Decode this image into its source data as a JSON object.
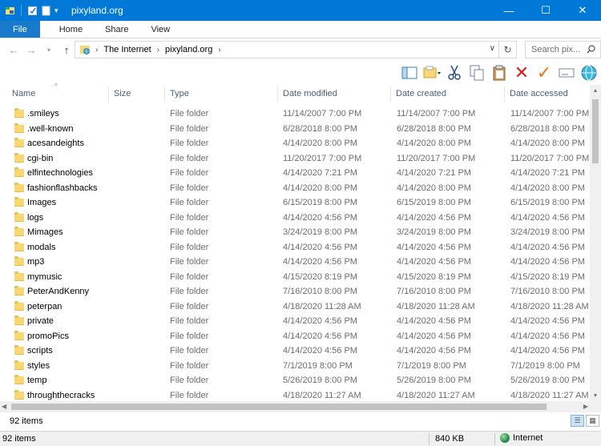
{
  "window": {
    "title": "pixyland.org",
    "controls": {
      "minimize": "—",
      "maximize": "☐",
      "close": "✕"
    }
  },
  "ribbon": {
    "tabs": [
      {
        "label": "File"
      },
      {
        "label": "Home"
      },
      {
        "label": "Share"
      },
      {
        "label": "View"
      }
    ]
  },
  "address": {
    "breadcrumbs": [
      "The Internet",
      "pixyland.org"
    ],
    "search_placeholder": "Search pix..."
  },
  "toolbar": {
    "icons": [
      "layout-icon",
      "folder-options-icon",
      "cut-icon",
      "copy-icon",
      "paste-icon",
      "delete-icon",
      "check-icon",
      "rename-icon",
      "globe-icon"
    ]
  },
  "columns": {
    "name": "Name",
    "size": "Size",
    "type": "Type",
    "modified": "Date modified",
    "created": "Date created",
    "accessed": "Date accessed"
  },
  "files": [
    {
      "name": ".smileys",
      "type": "File folder",
      "modified": "11/14/2007 7:00 PM",
      "created": "11/14/2007 7:00 PM",
      "accessed": "11/14/2007 7:00 PM"
    },
    {
      "name": ".well-known",
      "type": "File folder",
      "modified": "6/28/2018 8:00 PM",
      "created": "6/28/2018 8:00 PM",
      "accessed": "6/28/2018 8:00 PM"
    },
    {
      "name": "acesandeights",
      "type": "File folder",
      "modified": "4/14/2020 8:00 PM",
      "created": "4/14/2020 8:00 PM",
      "accessed": "4/14/2020 8:00 PM"
    },
    {
      "name": "cgi-bin",
      "type": "File folder",
      "modified": "11/20/2017 7:00 PM",
      "created": "11/20/2017 7:00 PM",
      "accessed": "11/20/2017 7:00 PM"
    },
    {
      "name": "elfintechnologies",
      "type": "File folder",
      "modified": "4/14/2020 7:21 PM",
      "created": "4/14/2020 7:21 PM",
      "accessed": "4/14/2020 7:21 PM"
    },
    {
      "name": "fashionflashbacks",
      "type": "File folder",
      "modified": "4/14/2020 8:00 PM",
      "created": "4/14/2020 8:00 PM",
      "accessed": "4/14/2020 8:00 PM"
    },
    {
      "name": "Images",
      "type": "File folder",
      "modified": "6/15/2019 8:00 PM",
      "created": "6/15/2019 8:00 PM",
      "accessed": "6/15/2019 8:00 PM"
    },
    {
      "name": "logs",
      "type": "File folder",
      "modified": "4/14/2020 4:56 PM",
      "created": "4/14/2020 4:56 PM",
      "accessed": "4/14/2020 4:56 PM"
    },
    {
      "name": "Mimages",
      "type": "File folder",
      "modified": "3/24/2019 8:00 PM",
      "created": "3/24/2019 8:00 PM",
      "accessed": "3/24/2019 8:00 PM"
    },
    {
      "name": "modals",
      "type": "File folder",
      "modified": "4/14/2020 4:56 PM",
      "created": "4/14/2020 4:56 PM",
      "accessed": "4/14/2020 4:56 PM"
    },
    {
      "name": "mp3",
      "type": "File folder",
      "modified": "4/14/2020 4:56 PM",
      "created": "4/14/2020 4:56 PM",
      "accessed": "4/14/2020 4:56 PM"
    },
    {
      "name": "mymusic",
      "type": "File folder",
      "modified": "4/15/2020 8:19 PM",
      "created": "4/15/2020 8:19 PM",
      "accessed": "4/15/2020 8:19 PM"
    },
    {
      "name": "PeterAndKenny",
      "type": "File folder",
      "modified": "7/16/2010 8:00 PM",
      "created": "7/16/2010 8:00 PM",
      "accessed": "7/16/2010 8:00 PM"
    },
    {
      "name": "peterpan",
      "type": "File folder",
      "modified": "4/18/2020 11:28 AM",
      "created": "4/18/2020 11:28 AM",
      "accessed": "4/18/2020 11:28 AM"
    },
    {
      "name": "private",
      "type": "File folder",
      "modified": "4/14/2020 4:56 PM",
      "created": "4/14/2020 4:56 PM",
      "accessed": "4/14/2020 4:56 PM"
    },
    {
      "name": "promoPics",
      "type": "File folder",
      "modified": "4/14/2020 4:56 PM",
      "created": "4/14/2020 4:56 PM",
      "accessed": "4/14/2020 4:56 PM"
    },
    {
      "name": "scripts",
      "type": "File folder",
      "modified": "4/14/2020 4:56 PM",
      "created": "4/14/2020 4:56 PM",
      "accessed": "4/14/2020 4:56 PM"
    },
    {
      "name": "styles",
      "type": "File folder",
      "modified": "7/1/2019 8:00 PM",
      "created": "7/1/2019 8:00 PM",
      "accessed": "7/1/2019 8:00 PM"
    },
    {
      "name": "temp",
      "type": "File folder",
      "modified": "5/26/2019 8:00 PM",
      "created": "5/26/2019 8:00 PM",
      "accessed": "5/26/2019 8:00 PM"
    },
    {
      "name": "throughthecracks",
      "type": "File folder",
      "modified": "4/18/2020 11:27 AM",
      "created": "4/18/2020 11:27 AM",
      "accessed": "4/18/2020 11:27 AM"
    }
  ],
  "status": {
    "item_count": "92 items",
    "outer_item_count": "92 items",
    "size": "840 KB",
    "zone": "Internet"
  },
  "colors": {
    "titlebar": "#0078d7",
    "file_tab": "#1979ca",
    "folder": "#f8d775"
  }
}
